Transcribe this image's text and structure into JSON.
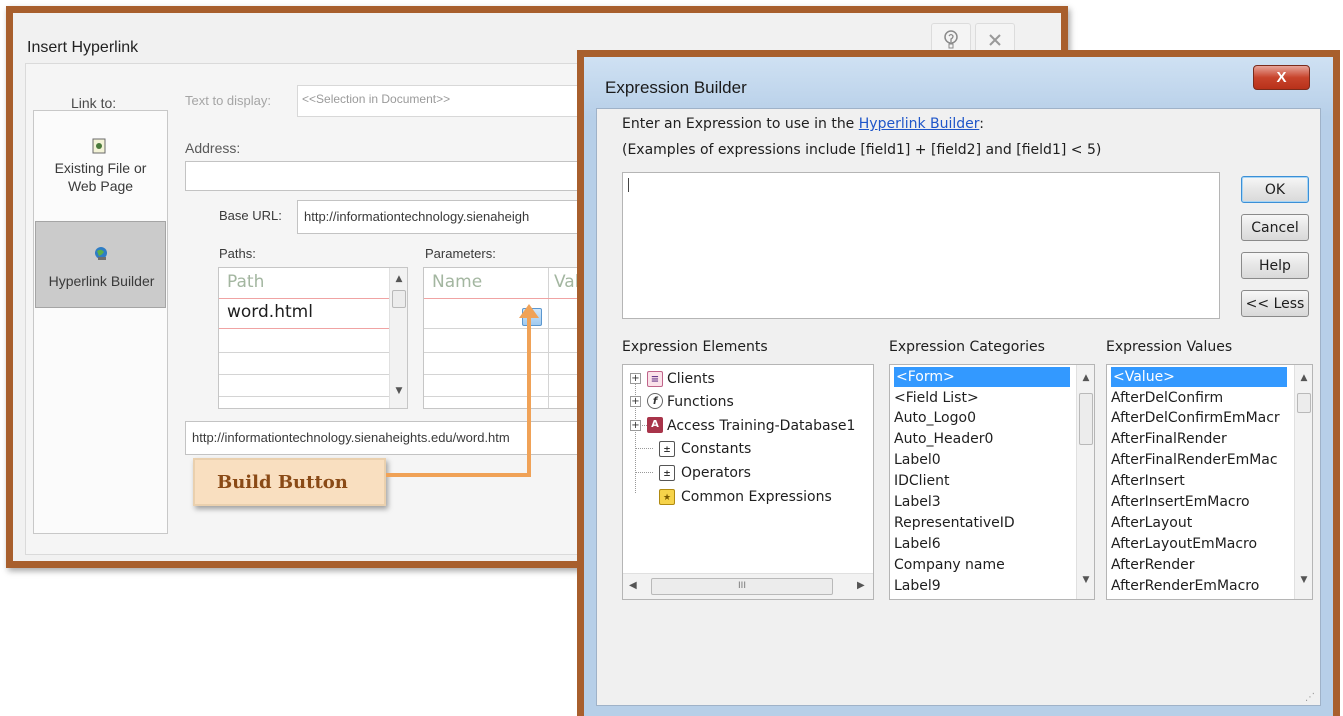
{
  "insert_hyperlink": {
    "title": "Insert Hyperlink",
    "help_icon": "help-icon",
    "close_icon": "close-icon",
    "link_to_label": "Link to:",
    "text_to_display_label": "Text to display:",
    "text_to_display_value": "<<Selection in Document>>",
    "address_label": "Address:",
    "link_to_items": [
      {
        "line1": "Existing File or",
        "line2": "Web Page"
      },
      {
        "line1": "Hyperlink Builder",
        "line2": ""
      }
    ],
    "base_url_label": "Base URL:",
    "base_url_value": "http://informationtechnology.sienaheigh",
    "paths_label": "Paths:",
    "paths_header": "Path",
    "paths_values": [
      "word.html"
    ],
    "parameters_label": "Parameters:",
    "params_headers": [
      "Name",
      "Valu"
    ],
    "url_preview": "http://informationtechnology.sienaheights.edu/word.htm"
  },
  "callout": {
    "text": "Build Button"
  },
  "expression_builder": {
    "title": "Expression Builder",
    "close_label": "X",
    "prompt_prefix": "Enter an Expression to use in the ",
    "prompt_link": "Hyperlink Builder",
    "prompt_suffix": ":",
    "examples": "(Examples of expressions include [field1] + [field2] and [field1] < 5)",
    "expression_value": "",
    "buttons": {
      "ok": "OK",
      "cancel": "Cancel",
      "help": "Help",
      "less": "<< Less"
    },
    "elements_label": "Expression Elements",
    "categories_label": "Expression Categories",
    "values_label": "Expression Values",
    "elements": [
      "Clients",
      "Functions",
      "Access Training-Database1",
      "Constants",
      "Operators",
      "Common Expressions"
    ],
    "categories": [
      "<Form>",
      "<Field List>",
      "Auto_Logo0",
      "Auto_Header0",
      "Label0",
      "IDClient",
      "Label3",
      "RepresentativeID",
      "Label6",
      "Company name",
      "Label9"
    ],
    "selected_category": "<Form>",
    "values": [
      "<Value>",
      "AfterDelConfirm",
      "AfterDelConfirmEmMacr",
      "AfterFinalRender",
      "AfterFinalRenderEmMac",
      "AfterInsert",
      "AfterInsertEmMacro",
      "AfterLayout",
      "AfterLayoutEmMacro",
      "AfterRender",
      "AfterRenderEmMacro"
    ],
    "selected_value": "<Value>",
    "hscroll_glyph": "III"
  }
}
